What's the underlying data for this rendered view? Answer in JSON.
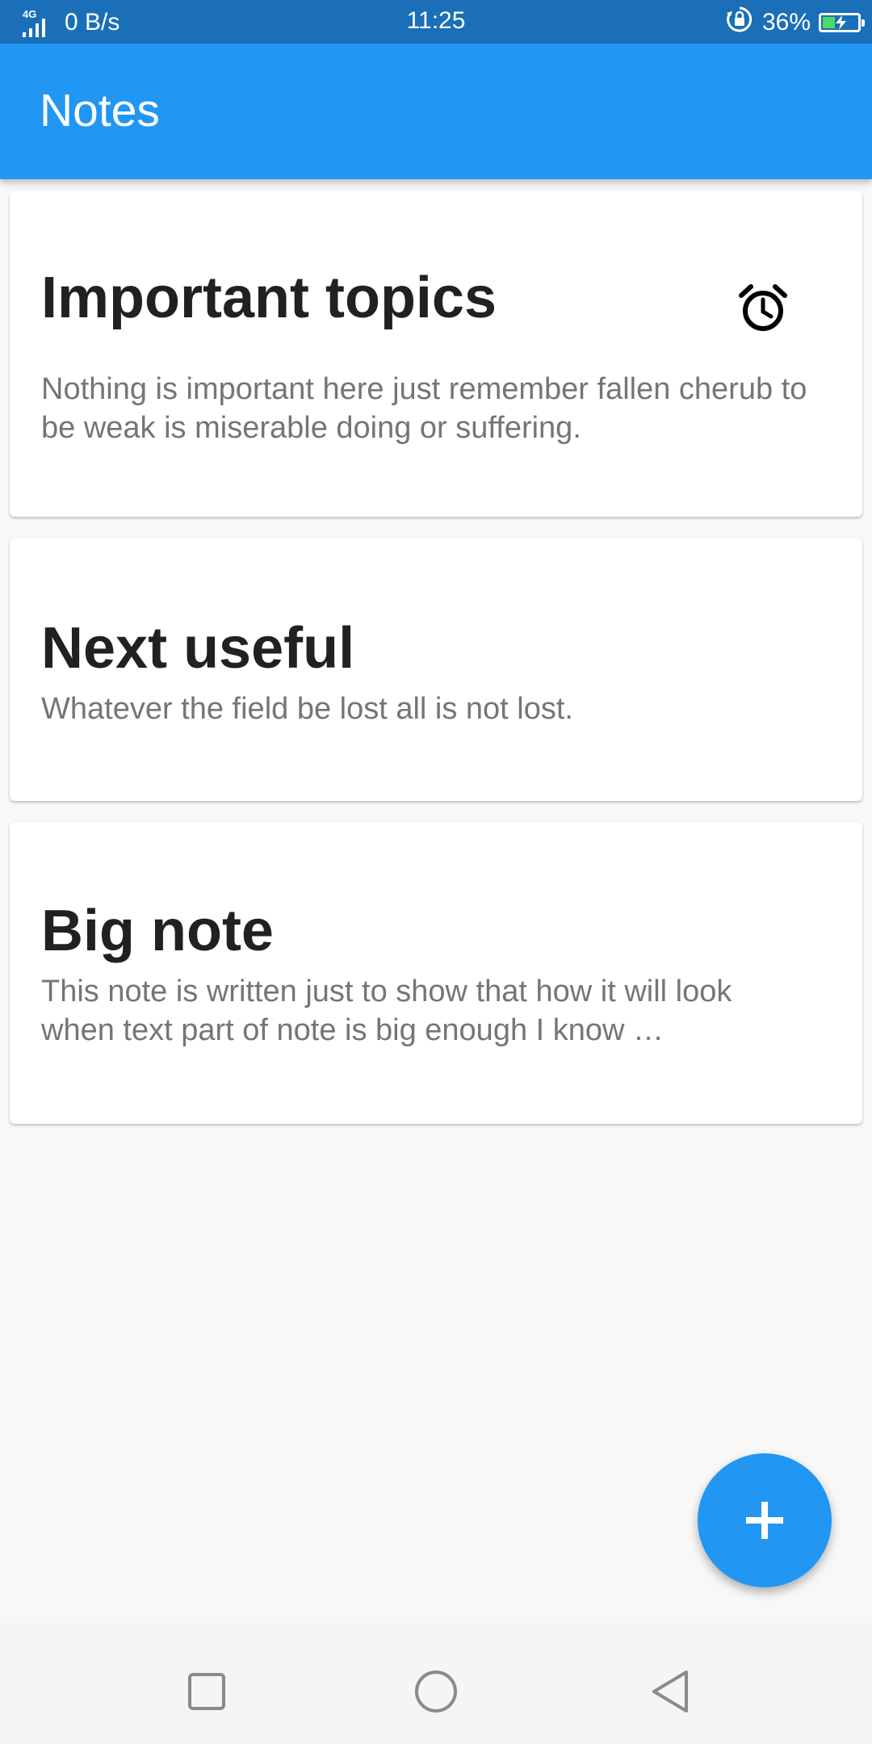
{
  "status_bar": {
    "network": "4G",
    "speed": "0 B/s",
    "time": "11:25",
    "battery_percent": "36%",
    "battery_level": 0.36,
    "icons": [
      "signal-icon",
      "rotation-lock-icon",
      "battery-charging-icon"
    ]
  },
  "app_bar": {
    "title": "Notes",
    "color": "#2196f3"
  },
  "notes": [
    {
      "title": "Important topics",
      "body": "Nothing is important here just remember fallen cherub to be weak is miserable doing or suffering.",
      "has_alarm": true
    },
    {
      "title": "Next useful",
      "body": "Whatever the field be lost all is not lost.",
      "has_alarm": false
    },
    {
      "title": "Big note",
      "body": "This note is written just to show that how it will look when text part of note is big enough I know …",
      "has_alarm": false
    }
  ],
  "fab": {
    "icon": "plus-icon"
  },
  "nav_bar": {
    "buttons": [
      "recent-apps-icon",
      "home-icon",
      "back-icon"
    ]
  }
}
